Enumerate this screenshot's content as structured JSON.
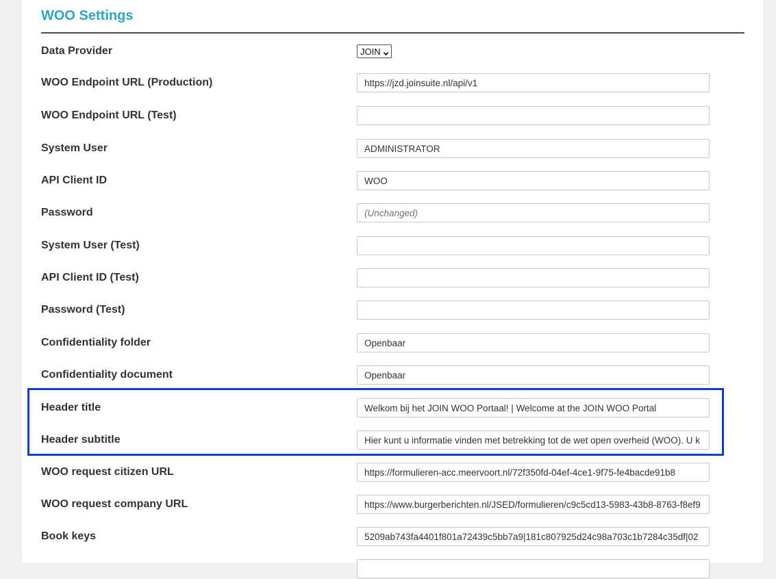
{
  "section": {
    "title": "WOO Settings"
  },
  "fields": {
    "data_provider": {
      "label": "Data Provider",
      "selected": "JOIN",
      "icon": "chevron-down-icon"
    },
    "endpoint_production": {
      "label": "WOO Endpoint URL (Production)",
      "value": "https://jzd.joinsuite.nl/api/v1"
    },
    "endpoint_test": {
      "label": "WOO Endpoint URL (Test)",
      "value": ""
    },
    "system_user": {
      "label": "System User",
      "value": "ADMINISTRATOR"
    },
    "api_client_id": {
      "label": "API Client ID",
      "value": "WOO"
    },
    "password": {
      "label": "Password",
      "placeholder": "(Unchanged)"
    },
    "system_user_test": {
      "label": "System User (Test)",
      "value": ""
    },
    "api_client_id_test": {
      "label": "API Client ID (Test)",
      "value": ""
    },
    "password_test": {
      "label": "Password (Test)",
      "value": ""
    },
    "confidentiality_folder": {
      "label": "Confidentiality folder",
      "value": "Openbaar"
    },
    "confidentiality_document": {
      "label": "Confidentiality document",
      "value": "Openbaar"
    },
    "header_title": {
      "label": "Header title",
      "value": "Welkom bij het JOIN WOO Portaal! | Welcome at the JOIN WOO Portal"
    },
    "header_subtitle": {
      "label": "Header subtitle",
      "value": "Hier kunt u informatie vinden met betrekking tot de wet open overheid (WOO). U k"
    },
    "request_citizen_url": {
      "label": "WOO request citizen URL",
      "value": "https://formulieren-acc.meervoort.nl/72f350fd-04ef-4ce1-9f75-fe4bacde91b8"
    },
    "request_company_url": {
      "label": "WOO request company URL",
      "value": "https://www.burgerberichten.nl/JSED/formulieren/c9c5cd13-5983-43b8-8763-f8ef9"
    },
    "book_keys": {
      "label": "Book keys",
      "value": "5209ab743fa4401f801a72439c5bb7a9|181c807925d24c98a703c1b7284c35df|02"
    }
  },
  "colors": {
    "title": "#2fa4c4",
    "highlight": "#0a41c9"
  }
}
